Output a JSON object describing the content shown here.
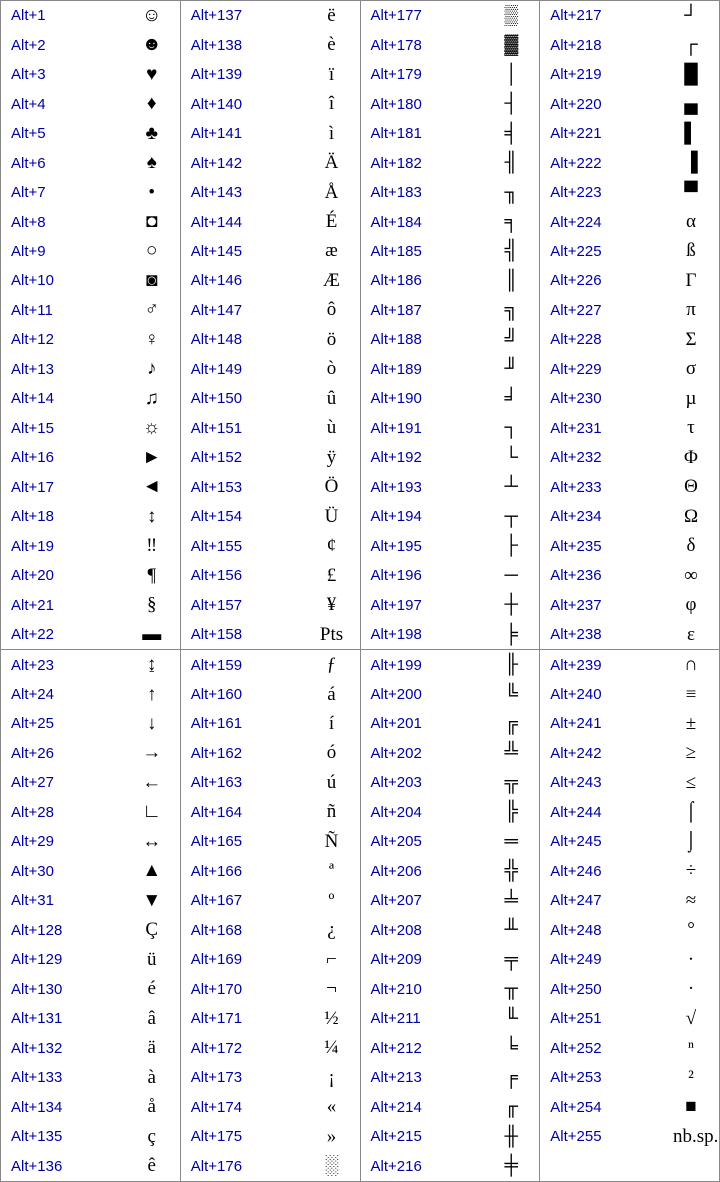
{
  "columns": [
    {
      "cutAfter": 21,
      "rows": [
        {
          "code": "Alt+1",
          "sym": "☺"
        },
        {
          "code": "Alt+2",
          "sym": "☻"
        },
        {
          "code": "Alt+3",
          "sym": "♥"
        },
        {
          "code": "Alt+4",
          "sym": "♦"
        },
        {
          "code": "Alt+5",
          "sym": "♣"
        },
        {
          "code": "Alt+6",
          "sym": "♠"
        },
        {
          "code": "Alt+7",
          "sym": "•"
        },
        {
          "code": "Alt+8",
          "sym": "◘"
        },
        {
          "code": "Alt+9",
          "sym": "○"
        },
        {
          "code": "Alt+10",
          "sym": "◙"
        },
        {
          "code": "Alt+11",
          "sym": "♂"
        },
        {
          "code": "Alt+12",
          "sym": "♀"
        },
        {
          "code": "Alt+13",
          "sym": "♪"
        },
        {
          "code": "Alt+14",
          "sym": "♫"
        },
        {
          "code": "Alt+15",
          "sym": "☼"
        },
        {
          "code": "Alt+16",
          "sym": "►"
        },
        {
          "code": "Alt+17",
          "sym": "◄"
        },
        {
          "code": "Alt+18",
          "sym": "↕"
        },
        {
          "code": "Alt+19",
          "sym": "‼"
        },
        {
          "code": "Alt+20",
          "sym": "¶"
        },
        {
          "code": "Alt+21",
          "sym": "§"
        },
        {
          "code": "Alt+22",
          "sym": "▬"
        },
        {
          "code": "Alt+23",
          "sym": "↨"
        },
        {
          "code": "Alt+24",
          "sym": "↑"
        },
        {
          "code": "Alt+25",
          "sym": "↓"
        },
        {
          "code": "Alt+26",
          "sym": "→"
        },
        {
          "code": "Alt+27",
          "sym": "←"
        },
        {
          "code": "Alt+28",
          "sym": "∟"
        },
        {
          "code": "Alt+29",
          "sym": "↔"
        },
        {
          "code": "Alt+30",
          "sym": "▲"
        },
        {
          "code": "Alt+31",
          "sym": "▼"
        },
        {
          "code": "Alt+128",
          "sym": "Ç"
        },
        {
          "code": "Alt+129",
          "sym": "ü"
        },
        {
          "code": "Alt+130",
          "sym": "é"
        },
        {
          "code": "Alt+131",
          "sym": "â"
        },
        {
          "code": "Alt+132",
          "sym": "ä"
        },
        {
          "code": "Alt+133",
          "sym": "à"
        },
        {
          "code": "Alt+134",
          "sym": "å"
        },
        {
          "code": "Alt+135",
          "sym": "ç"
        },
        {
          "code": "Alt+136",
          "sym": "ê"
        }
      ]
    },
    {
      "cutAfter": 21,
      "rows": [
        {
          "code": "Alt+137",
          "sym": "ë"
        },
        {
          "code": "Alt+138",
          "sym": "è"
        },
        {
          "code": "Alt+139",
          "sym": "ï"
        },
        {
          "code": "Alt+140",
          "sym": "î"
        },
        {
          "code": "Alt+141",
          "sym": "ì"
        },
        {
          "code": "Alt+142",
          "sym": "Ä"
        },
        {
          "code": "Alt+143",
          "sym": "Å"
        },
        {
          "code": "Alt+144",
          "sym": "É"
        },
        {
          "code": "Alt+145",
          "sym": "æ"
        },
        {
          "code": "Alt+146",
          "sym": "Æ"
        },
        {
          "code": "Alt+147",
          "sym": "ô"
        },
        {
          "code": "Alt+148",
          "sym": "ö"
        },
        {
          "code": "Alt+149",
          "sym": "ò"
        },
        {
          "code": "Alt+150",
          "sym": "û"
        },
        {
          "code": "Alt+151",
          "sym": "ù"
        },
        {
          "code": "Alt+152",
          "sym": "ÿ"
        },
        {
          "code": "Alt+153",
          "sym": "Ö"
        },
        {
          "code": "Alt+154",
          "sym": "Ü"
        },
        {
          "code": "Alt+155",
          "sym": "¢"
        },
        {
          "code": "Alt+156",
          "sym": "£"
        },
        {
          "code": "Alt+157",
          "sym": "¥"
        },
        {
          "code": "Alt+158",
          "sym": "Pts"
        },
        {
          "code": "Alt+159",
          "sym": "ƒ"
        },
        {
          "code": "Alt+160",
          "sym": "á"
        },
        {
          "code": "Alt+161",
          "sym": "í"
        },
        {
          "code": "Alt+162",
          "sym": "ó"
        },
        {
          "code": "Alt+163",
          "sym": "ú"
        },
        {
          "code": "Alt+164",
          "sym": "ñ"
        },
        {
          "code": "Alt+165",
          "sym": "Ñ"
        },
        {
          "code": "Alt+166",
          "sym": "ª"
        },
        {
          "code": "Alt+167",
          "sym": "º"
        },
        {
          "code": "Alt+168",
          "sym": "¿"
        },
        {
          "code": "Alt+169",
          "sym": "⌐"
        },
        {
          "code": "Alt+170",
          "sym": "¬"
        },
        {
          "code": "Alt+171",
          "sym": "½"
        },
        {
          "code": "Alt+172",
          "sym": "¼"
        },
        {
          "code": "Alt+173",
          "sym": "¡"
        },
        {
          "code": "Alt+174",
          "sym": "«"
        },
        {
          "code": "Alt+175",
          "sym": "»"
        },
        {
          "code": "Alt+176",
          "sym": "░"
        }
      ]
    },
    {
      "cutAfter": 21,
      "rows": [
        {
          "code": "Alt+177",
          "sym": "▒"
        },
        {
          "code": "Alt+178",
          "sym": "▓"
        },
        {
          "code": "Alt+179",
          "sym": "│"
        },
        {
          "code": "Alt+180",
          "sym": "┤"
        },
        {
          "code": "Alt+181",
          "sym": "╡"
        },
        {
          "code": "Alt+182",
          "sym": "╢"
        },
        {
          "code": "Alt+183",
          "sym": "╖"
        },
        {
          "code": "Alt+184",
          "sym": "╕"
        },
        {
          "code": "Alt+185",
          "sym": "╣"
        },
        {
          "code": "Alt+186",
          "sym": "║"
        },
        {
          "code": "Alt+187",
          "sym": "╗"
        },
        {
          "code": "Alt+188",
          "sym": "╝"
        },
        {
          "code": "Alt+189",
          "sym": "╜"
        },
        {
          "code": "Alt+190",
          "sym": "╛"
        },
        {
          "code": "Alt+191",
          "sym": "┐"
        },
        {
          "code": "Alt+192",
          "sym": "└"
        },
        {
          "code": "Alt+193",
          "sym": "┴"
        },
        {
          "code": "Alt+194",
          "sym": "┬"
        },
        {
          "code": "Alt+195",
          "sym": "├"
        },
        {
          "code": "Alt+196",
          "sym": "─"
        },
        {
          "code": "Alt+197",
          "sym": "┼"
        },
        {
          "code": "Alt+198",
          "sym": "╞"
        },
        {
          "code": "Alt+199",
          "sym": "╟"
        },
        {
          "code": "Alt+200",
          "sym": "╚"
        },
        {
          "code": "Alt+201",
          "sym": "╔"
        },
        {
          "code": "Alt+202",
          "sym": "╩"
        },
        {
          "code": "Alt+203",
          "sym": "╦"
        },
        {
          "code": "Alt+204",
          "sym": "╠"
        },
        {
          "code": "Alt+205",
          "sym": "═"
        },
        {
          "code": "Alt+206",
          "sym": "╬"
        },
        {
          "code": "Alt+207",
          "sym": "╧"
        },
        {
          "code": "Alt+208",
          "sym": "╨"
        },
        {
          "code": "Alt+209",
          "sym": "╤"
        },
        {
          "code": "Alt+210",
          "sym": "╥"
        },
        {
          "code": "Alt+211",
          "sym": "╙"
        },
        {
          "code": "Alt+212",
          "sym": "╘"
        },
        {
          "code": "Alt+213",
          "sym": "╒"
        },
        {
          "code": "Alt+214",
          "sym": "╓"
        },
        {
          "code": "Alt+215",
          "sym": "╫"
        },
        {
          "code": "Alt+216",
          "sym": "╪"
        }
      ]
    },
    {
      "cutAfter": 21,
      "rows": [
        {
          "code": "Alt+217",
          "sym": "┘"
        },
        {
          "code": "Alt+218",
          "sym": "┌"
        },
        {
          "code": "Alt+219",
          "sym": "█"
        },
        {
          "code": "Alt+220",
          "sym": "▄"
        },
        {
          "code": "Alt+221",
          "sym": "▌"
        },
        {
          "code": "Alt+222",
          "sym": "▐"
        },
        {
          "code": "Alt+223",
          "sym": "▀"
        },
        {
          "code": "Alt+224",
          "sym": "α"
        },
        {
          "code": "Alt+225",
          "sym": "ß"
        },
        {
          "code": "Alt+226",
          "sym": "Γ"
        },
        {
          "code": "Alt+227",
          "sym": "π"
        },
        {
          "code": "Alt+228",
          "sym": "Σ"
        },
        {
          "code": "Alt+229",
          "sym": "σ"
        },
        {
          "code": "Alt+230",
          "sym": "µ"
        },
        {
          "code": "Alt+231",
          "sym": "τ"
        },
        {
          "code": "Alt+232",
          "sym": "Φ"
        },
        {
          "code": "Alt+233",
          "sym": "Θ"
        },
        {
          "code": "Alt+234",
          "sym": "Ω"
        },
        {
          "code": "Alt+235",
          "sym": "δ"
        },
        {
          "code": "Alt+236",
          "sym": "∞"
        },
        {
          "code": "Alt+237",
          "sym": "φ"
        },
        {
          "code": "Alt+238",
          "sym": "ε"
        },
        {
          "code": "Alt+239",
          "sym": "∩"
        },
        {
          "code": "Alt+240",
          "sym": "≡"
        },
        {
          "code": "Alt+241",
          "sym": "±"
        },
        {
          "code": "Alt+242",
          "sym": "≥"
        },
        {
          "code": "Alt+243",
          "sym": "≤"
        },
        {
          "code": "Alt+244",
          "sym": "⌠"
        },
        {
          "code": "Alt+245",
          "sym": "⌡"
        },
        {
          "code": "Alt+246",
          "sym": "÷"
        },
        {
          "code": "Alt+247",
          "sym": "≈"
        },
        {
          "code": "Alt+248",
          "sym": "°"
        },
        {
          "code": "Alt+249",
          "sym": "∙"
        },
        {
          "code": "Alt+250",
          "sym": "·"
        },
        {
          "code": "Alt+251",
          "sym": "√"
        },
        {
          "code": "Alt+252",
          "sym": "ⁿ"
        },
        {
          "code": "Alt+253",
          "sym": "²"
        },
        {
          "code": "Alt+254",
          "sym": "■"
        },
        {
          "code": "Alt+255",
          "sym": "nb.sp."
        },
        {
          "code": "",
          "sym": ""
        }
      ]
    }
  ]
}
